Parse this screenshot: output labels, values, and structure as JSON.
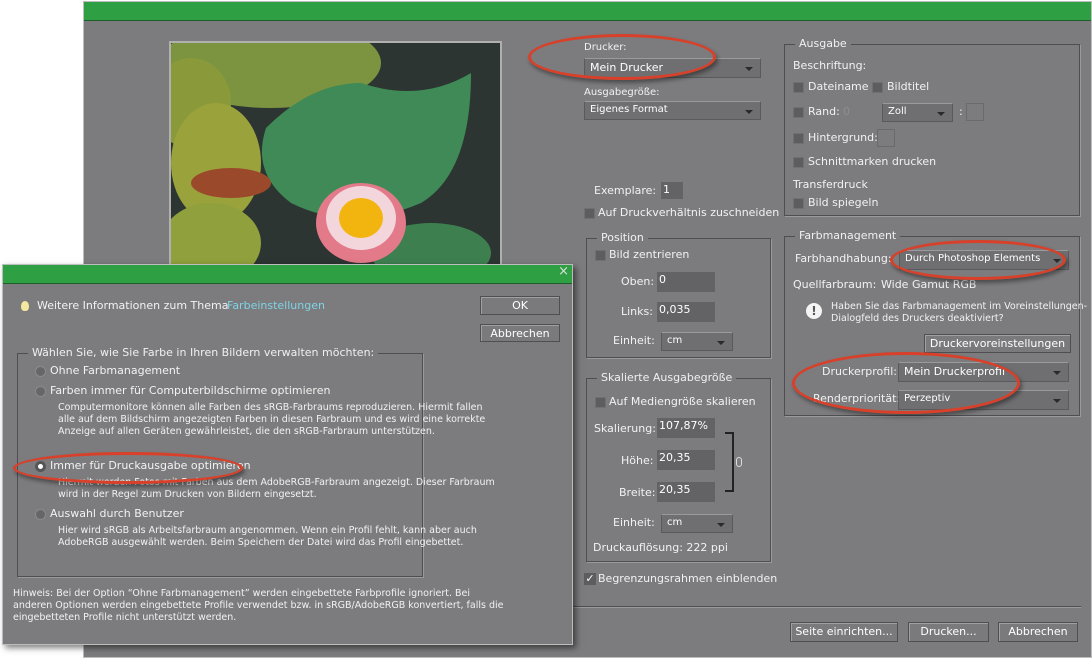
{
  "print_dialog": {
    "printer": {
      "label": "Drucker:",
      "value": "Mein Drucker"
    },
    "output_size": {
      "label": "Ausgabegröße:",
      "value": "Eigenes Format"
    },
    "copies": {
      "label": "Exemplare:",
      "value": "1"
    },
    "crop_to_ratio": "Auf Druckverhältnis zuschneiden",
    "position": {
      "title": "Position",
      "center": "Bild zentrieren",
      "top_label": "Oben:",
      "top_value": "0",
      "left_label": "Links:",
      "left_value": "0,035",
      "unit_label": "Einheit:",
      "unit_value": "cm"
    },
    "scaled": {
      "title": "Skalierte Ausgabegröße",
      "scale_to_media": "Auf Mediengröße skalieren",
      "scale_label": "Skalierung:",
      "scale_value": "107,87%",
      "height_label": "Höhe:",
      "height_value": "20,35",
      "width_label": "Breite:",
      "width_value": "20,35",
      "unit_label": "Einheit:",
      "unit_value": "cm",
      "resolution": "Druckauflösung: 222 ppi"
    },
    "show_bounding_box": "Begrenzungsrahmen einblenden",
    "output": {
      "title": "Ausgabe",
      "caption_label": "Beschriftung:",
      "filename": "Dateiname",
      "image_title": "Bildtitel",
      "border": "Rand:",
      "border_value": "0",
      "border_unit": "Zoll",
      "background": "Hintergrund:",
      "crop_marks": "Schnittmarken drucken",
      "transfer_label": "Transferdruck",
      "mirror": "Bild spiegeln"
    },
    "color_management": {
      "title": "Farbmanagement",
      "handling_label": "Farbhandhabung:",
      "handling_value": "Durch Photoshop Elements",
      "source_label": "Quellfarbraum:",
      "source_value": "Wide Gamut RGB",
      "warning": [
        "Haben Sie das Farbmanagement im Voreinstellungen-",
        "Dialogfeld des Druckers deaktiviert?"
      ],
      "printer_prefs_button": "Druckervoreinstellungen",
      "profile_label": "Druckerprofil:",
      "profile_value": "Mein Druckerprofil",
      "intent_label": "Renderpriorität:",
      "intent_value": "Perzeptiv"
    },
    "buttons": {
      "page_setup": "Seite einrichten...",
      "print": "Drucken...",
      "cancel": "Abbrechen"
    }
  },
  "color_dialog": {
    "info_text": "Weitere Informationen zum Thema",
    "info_link": "Farbeinstellungen",
    "ok": "OK",
    "cancel": "Abbrechen",
    "group_title": "Wählen Sie, wie Sie Farbe in Ihren Bildern verwalten möchten:",
    "options": [
      {
        "label": "Ohne Farbmanagement",
        "desc": []
      },
      {
        "label": "Farben immer für Computerbildschirme optimieren",
        "desc": [
          "Computermonitore können alle Farben des sRGB-Farbraums reproduzieren. Hiermit fallen",
          "alle auf dem Bildschirm angezeigten Farben in diesen Farbraum und es wird eine korrekte",
          "Anzeige auf allen Geräten gewährleistet, die den sRGB-Farbraum unterstützen."
        ]
      },
      {
        "label": "Immer für Druckausgabe optimieren",
        "desc": [
          "Hiermit werden Fotos mit Farben aus dem AdobeRGB-Farbraum angezeigt. Dieser Farbraum",
          "wird in der Regel zum Drucken von Bildern eingesetzt."
        ]
      },
      {
        "label": "Auswahl durch Benutzer",
        "desc": [
          "Hier wird sRGB als Arbeitsfarbraum angenommen. Wenn ein Profil fehlt, kann aber auch",
          "AdobeRGB ausgewählt werden. Beim Speichern der Datei wird das Profil eingebettet."
        ]
      }
    ],
    "selected_option": 2,
    "note": [
      "Hinweis: Bei der Option “Ohne Farbmanagement” werden eingebettete Farbprofile ignoriert. Bei",
      "anderen Optionen werden eingebettete Profile verwendet bzw. in sRGB/AdobeRGB konvertiert, falls die",
      "eingebetteten Profile nicht unterstützt werden."
    ],
    "close_glyph": "×"
  },
  "colors": {
    "title_green": "#2ea043",
    "panel_gray": "#7c7c7e",
    "annotation_red": "#d8402a",
    "link": "#7fd3e6"
  }
}
